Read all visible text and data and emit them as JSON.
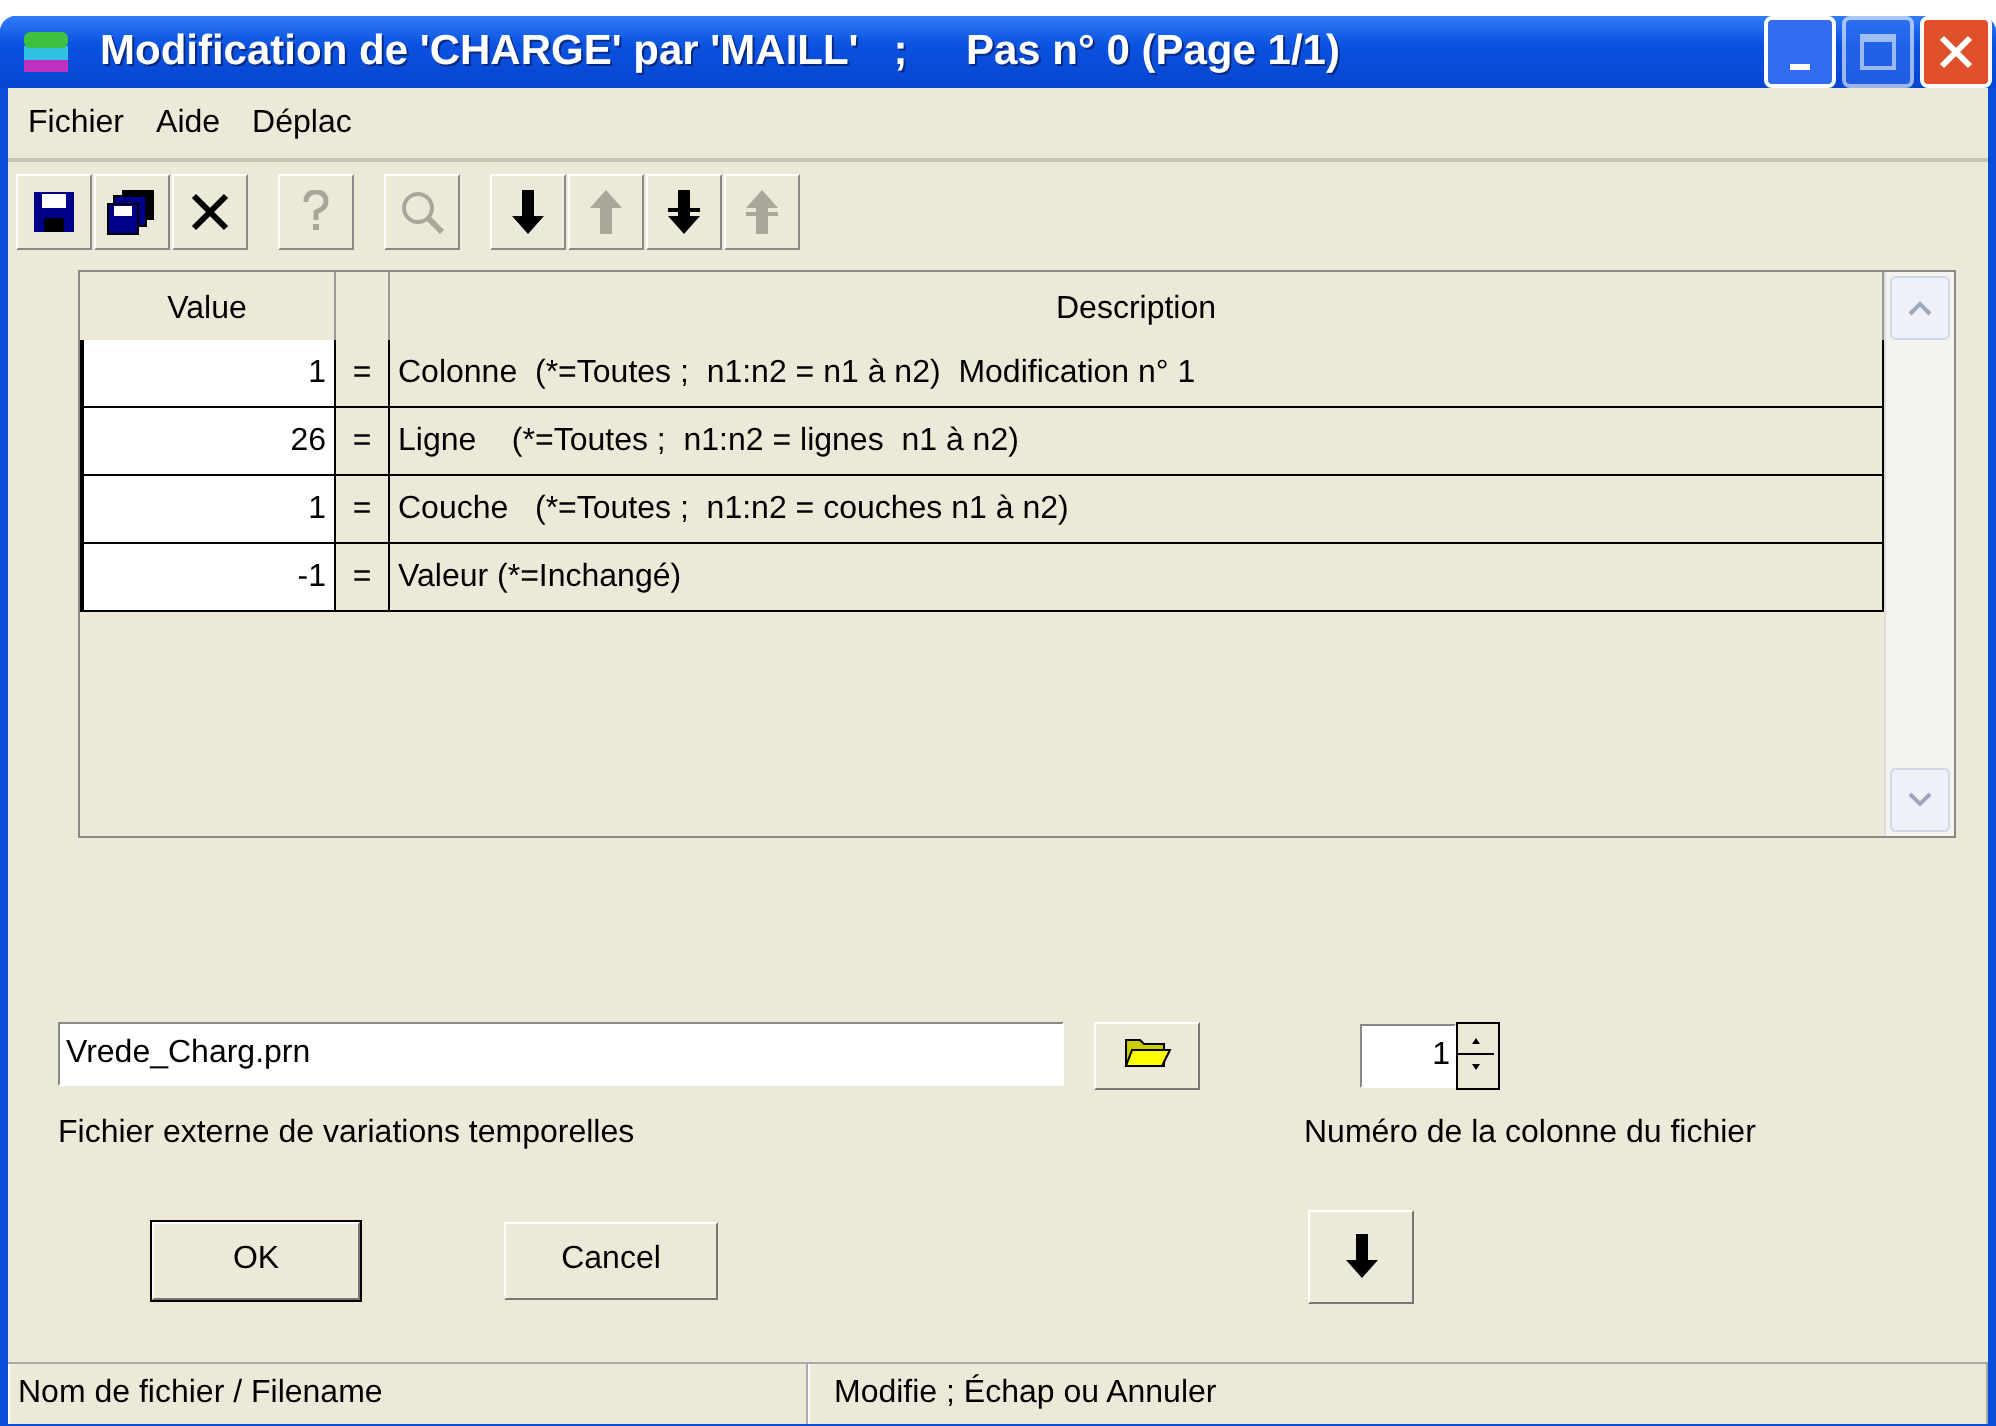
{
  "window": {
    "title": "Modification de 'CHARGE' par 'MAILL'   ;     Pas n° 0 (Page 1/1)"
  },
  "menu": [
    "Fichier",
    "Aide",
    "Déplac"
  ],
  "toolbar": [
    {
      "kind": "save",
      "disabled": false
    },
    {
      "kind": "save-all",
      "disabled": false
    },
    {
      "kind": "delete",
      "disabled": false
    },
    {
      "kind": "help",
      "disabled": true
    },
    {
      "kind": "zoom",
      "disabled": true
    },
    {
      "kind": "down",
      "disabled": false
    },
    {
      "kind": "up",
      "disabled": true
    },
    {
      "kind": "bottom",
      "disabled": false
    },
    {
      "kind": "top",
      "disabled": true
    }
  ],
  "table": {
    "columns": [
      "Value",
      "",
      "Description"
    ],
    "rows": [
      {
        "value": "1",
        "sign": "=",
        "description": "Colonne  (*=Toutes ;  n1:n2 = n1 à n2)  Modification n° 1"
      },
      {
        "value": "26",
        "sign": "=",
        "description": "Ligne    (*=Toutes ;  n1:n2 = lignes  n1 à n2)"
      },
      {
        "value": "1",
        "sign": "=",
        "description": "Couche   (*=Toutes ;  n1:n2 = couches n1 à n2)"
      },
      {
        "value": "-1",
        "sign": "=",
        "description": "Valeur (*=Inchangé)"
      }
    ]
  },
  "file": {
    "value": "Vrede_Charg.prn",
    "label": "Fichier externe de variations temporelles"
  },
  "column_number": {
    "value": "1",
    "label": "Numéro de la colonne du fichier"
  },
  "buttons": [
    "OK",
    "Cancel"
  ],
  "status_bar": [
    "Nom de fichier / Filename",
    "Modifie  ;  Échap ou Annuler"
  ]
}
